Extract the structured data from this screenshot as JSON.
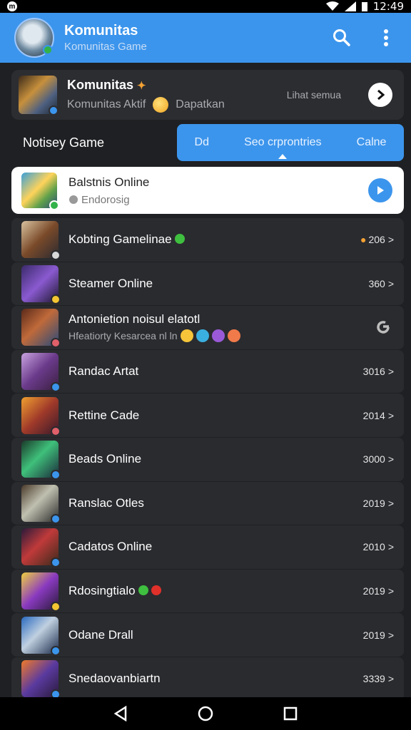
{
  "status": {
    "time": "12:49"
  },
  "header": {
    "title": "Komunitas",
    "subtitle": "Komunitas Game"
  },
  "featured": {
    "name": "Komunitas",
    "name_suffix": "✦",
    "desc_left": "Komunitas Aktif",
    "desc_right": "Dapatkan",
    "meta": "Lihat semua"
  },
  "tabs_row": {
    "label": "Notisey Game",
    "tabs": [
      "Dd",
      "Seo crprontries",
      "Calne"
    ]
  },
  "selected": {
    "name": "Balstnis Online",
    "sub": "Endorosig"
  },
  "games": [
    {
      "name": "Kobting Gamelinae",
      "count": "206"
    },
    {
      "name": "Steamer Online",
      "count": "360"
    },
    {
      "name": "Antonietion noisul elatotl",
      "sub": "Hfeatiorty Kesarcea nl ln"
    },
    {
      "name": "Randac Artat",
      "count": "3016"
    },
    {
      "name": "Rettine Cade",
      "count": "2014"
    },
    {
      "name": "Beads Online",
      "count": "3000"
    },
    {
      "name": "Ranslac Otles",
      "count": "2019"
    },
    {
      "name": "Cadatos Online",
      "count": "2010"
    },
    {
      "name": "Rdosingtialo",
      "count": "2019"
    },
    {
      "name": "Odane Drall",
      "count": "2019"
    },
    {
      "name": "Snedaovanbiartn",
      "count": "3339"
    }
  ],
  "colors": {
    "accent": "#3c95ec",
    "bg": "#1f2023",
    "card": "#2a2b2f"
  }
}
